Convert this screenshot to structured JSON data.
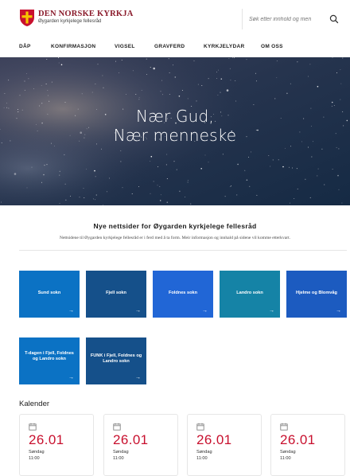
{
  "header": {
    "brand_title": "DEN NORSKE KYRKJA",
    "brand_subtitle": "Øygarden kyrkjelege fellesråd",
    "search_placeholder": "Søk etter innhold og men",
    "brand_color": "#8a1b2b"
  },
  "nav": {
    "items": [
      {
        "label": "DÅP"
      },
      {
        "label": "KONFIRMASJON"
      },
      {
        "label": "VIGSEL"
      },
      {
        "label": "GRAVFERD"
      },
      {
        "label": "KYRKJELYDAR"
      },
      {
        "label": "OM OSS"
      }
    ]
  },
  "hero": {
    "line1": "Nær Gud,",
    "line2": "Nær menneske"
  },
  "intro": {
    "title": "Nye nettsider for Øygarden kyrkjelege fellesråd",
    "text": "Nettsidene til Øygarden kyrkjelege fellesråd er i ferd med å ta form. Meir informasjon og innhald på sidene vil komme etterkvart."
  },
  "tiles": [
    {
      "label": "Sund sokn",
      "arrow": "→",
      "color": "#0b72c4"
    },
    {
      "label": "Fjell sokn",
      "arrow": "→",
      "color": "#15508a"
    },
    {
      "label": "Foldnes sokn",
      "arrow": "→",
      "color": "#2166d6"
    },
    {
      "label": "Landro sokn",
      "arrow": "→",
      "color": "#1583a6"
    },
    {
      "label": "Hjelme og Blomvåg",
      "arrow": "→",
      "color": "#1c5bc0"
    },
    {
      "label": "T-dagen i Fjell, Foldnes og Landro sokn",
      "arrow": "→",
      "color": "#0b72c4"
    },
    {
      "label": "FUNK i Fjell, Foldnes og Landro sokn",
      "arrow": "→",
      "color": "#15508a"
    }
  ],
  "calendar": {
    "title": "Kalender",
    "date_color": "#c8102e",
    "events": [
      {
        "date": "26.01",
        "day": "Søndag",
        "time": "11:00"
      },
      {
        "date": "26.01",
        "day": "Søndag",
        "time": "11:00"
      },
      {
        "date": "26.01",
        "day": "Søndag",
        "time": "11:00"
      },
      {
        "date": "26.01",
        "day": "Søndag",
        "time": "11:00"
      }
    ]
  },
  "icons": {
    "logo": "church-cross-shield-icon",
    "search": "search-icon",
    "calendar": "calendar-icon",
    "arrow": "arrow-right-icon"
  }
}
